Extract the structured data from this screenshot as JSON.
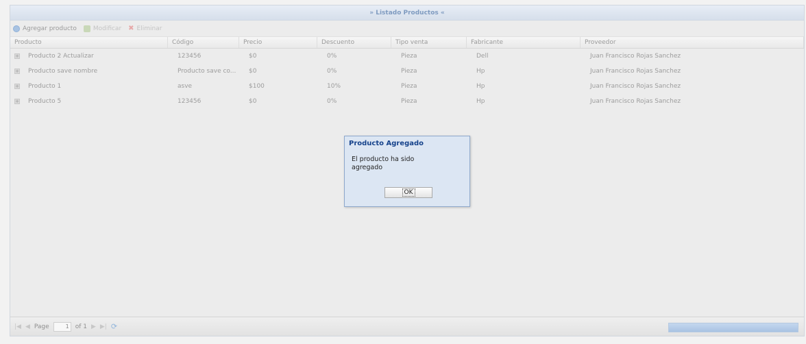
{
  "panel": {
    "title": "» Listado Productos «"
  },
  "toolbar": {
    "add_label": "Agregar producto",
    "edit_label": "Modificar",
    "delete_label": "Eliminar"
  },
  "grid": {
    "columns": [
      "Producto",
      "Código",
      "Precio",
      "Descuento",
      "Tipo venta",
      "Fabricante",
      "Proveedor"
    ],
    "rows": [
      [
        "Producto 2 Actualizar",
        "123456",
        "$0",
        "0%",
        "Pieza",
        "Dell",
        "Juan Francisco Rojas Sanchez"
      ],
      [
        "Producto save nombre",
        "Producto save co...",
        "$0",
        "0%",
        "Pieza",
        "Hp",
        "Juan Francisco Rojas Sanchez"
      ],
      [
        "Producto 1",
        "asve",
        "$100",
        "10%",
        "Pieza",
        "Hp",
        "Juan Francisco Rojas Sanchez"
      ],
      [
        "Producto 5",
        "123456",
        "$0",
        "0%",
        "Pieza",
        "Hp",
        "Juan Francisco Rojas Sanchez"
      ]
    ]
  },
  "paging": {
    "page_label": "Page",
    "page_value": "1",
    "of_label": "of 1"
  },
  "dialog": {
    "title": "Producto Agregado",
    "message": "El producto ha sido agregado",
    "ok_label": "OK"
  },
  "colors": {
    "dialog_title": "#15428b",
    "dialog_bg": "#dce6f3"
  }
}
